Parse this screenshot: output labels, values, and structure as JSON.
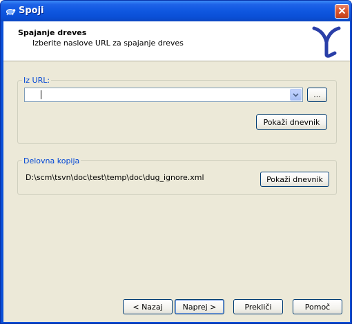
{
  "window": {
    "title": "Spoji"
  },
  "header": {
    "title": "Spajanje dreves",
    "subtitle": "Izberite naslove URL za spajanje dreves"
  },
  "url_group": {
    "label": "Iz URL:",
    "combo_value": "",
    "browse_label": "...",
    "show_log_label": "Pokaži dnevnik"
  },
  "wc_group": {
    "label": "Delovna kopija",
    "path": "D:\\scm\\tsvn\\doc\\test\\temp\\doc\\dug_ignore.xml",
    "show_log_label": "Pokaži dnevnik"
  },
  "footer": {
    "back_label": "< Nazaj",
    "next_label": "Naprej >",
    "cancel_label": "Prekliči",
    "help_label": "Pomoč"
  }
}
